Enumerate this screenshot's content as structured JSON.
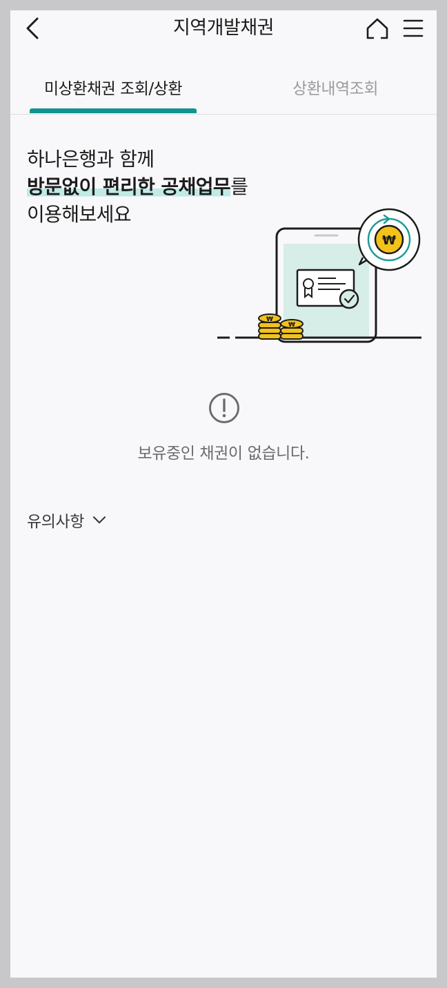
{
  "header": {
    "title": "지역개발채권",
    "back_icon": "chevron-left-icon",
    "home_icon": "home-icon",
    "menu_icon": "hamburger-menu-icon"
  },
  "tabs": [
    {
      "label": "미상환채권 조회/상환",
      "active": true
    },
    {
      "label": "상환내역조회",
      "active": false
    }
  ],
  "intro": {
    "line1": "하나은행과 함께",
    "line2_bold": "방문없이 편리한 공채업무",
    "line2_rest": "를",
    "line3": "이용해보세요"
  },
  "empty_state": {
    "icon": "exclamation-circle-icon",
    "text": "보유중인 채권이 없습니다."
  },
  "notice": {
    "label": "유의사항",
    "icon": "chevron-down-icon"
  },
  "colors": {
    "accent": "#0f9490",
    "highlight": "#bfeae6",
    "coin": "#f2c21b",
    "background": "#f8f8fa"
  }
}
